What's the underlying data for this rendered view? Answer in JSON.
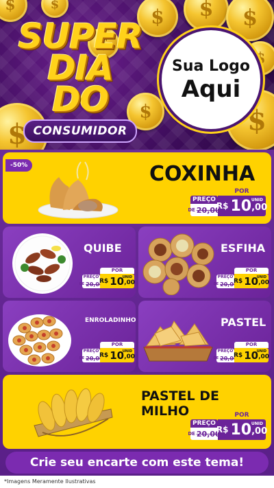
{
  "header": {
    "title_line1": "SUPER",
    "title_line2": "DIA DO",
    "title_badge": "CONSUMIDOR",
    "logo_line1": "Sua Logo",
    "logo_line2": "Aqui",
    "coin_symbol": "$"
  },
  "price_labels": {
    "de": "PREÇO",
    "de_prefix": "DE",
    "por": "POR",
    "currency": "R$",
    "unit": "UNID"
  },
  "discount_badge": "-50%",
  "products": [
    {
      "name": "COXINHA",
      "old_price": "20,00",
      "price_int": "10",
      "price_cents": ",00"
    },
    {
      "name": "QUIBE",
      "old_price": "20,00",
      "price_int": "10",
      "price_cents": ",00"
    },
    {
      "name": "ESFIHA",
      "old_price": "20,00",
      "price_int": "10",
      "price_cents": ",00"
    },
    {
      "name": "ENROLADINHO",
      "old_price": "20,00",
      "price_int": "10",
      "price_cents": ",00"
    },
    {
      "name": "PASTEL",
      "old_price": "20,00",
      "price_int": "10",
      "price_cents": ",00"
    },
    {
      "name": "PASTEL DE MILHO",
      "old_price": "20,00",
      "price_int": "10",
      "price_cents": ",00"
    }
  ],
  "cta": "Crie seu encarte com este tema!",
  "footer_note": "*Imagens Meramente Ilustrativas",
  "colors": {
    "purple": "#6b2399",
    "yellow": "#ffd200",
    "gold": "#f5c530"
  }
}
